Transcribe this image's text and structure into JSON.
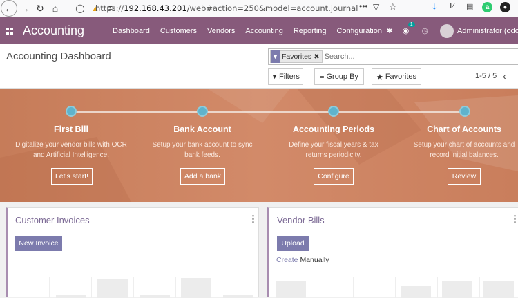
{
  "browser": {
    "url_prefix": "https://",
    "url_host": "192.168.43.201",
    "url_rest": "/web#action=250&model=account.journal",
    "more": "•••"
  },
  "navbar": {
    "brand": "Accounting",
    "menu": [
      "Dashboard",
      "Customers",
      "Vendors",
      "Accounting",
      "Reporting",
      "Configuration"
    ],
    "chat_badge": "1",
    "user": "Administrator (odoo",
    "color": "#875a7b"
  },
  "control": {
    "title": "Accounting Dashboard",
    "facet": "Favorites",
    "search_placeholder": "Search...",
    "filters_label": "Filters",
    "groupby_label": "Group By",
    "favorites_label": "Favorites",
    "pager": "1-5 / 5"
  },
  "onboarding": {
    "steps": [
      {
        "title": "First Bill",
        "desc1": "Digitalize your vendor bills with OCR",
        "desc2": "and Artificial Intelligence.",
        "button": "Let's start!"
      },
      {
        "title": "Bank Account",
        "desc1": "Setup your bank account to sync",
        "desc2": "bank feeds.",
        "button": "Add a bank"
      },
      {
        "title": "Accounting Periods",
        "desc1": "Define your fiscal years & tax",
        "desc2": "returns periodicity.",
        "button": "Configure"
      },
      {
        "title": "Chart of Accounts",
        "desc1": "Setup your chart of accounts and",
        "desc2": "record initial balances.",
        "button": "Review"
      }
    ]
  },
  "cards": {
    "customer": {
      "title": "Customer Invoices",
      "button": "New Invoice"
    },
    "vendor": {
      "title": "Vendor Bills",
      "button": "Upload",
      "create_word": "Create",
      "manually_word": "Manually"
    }
  }
}
